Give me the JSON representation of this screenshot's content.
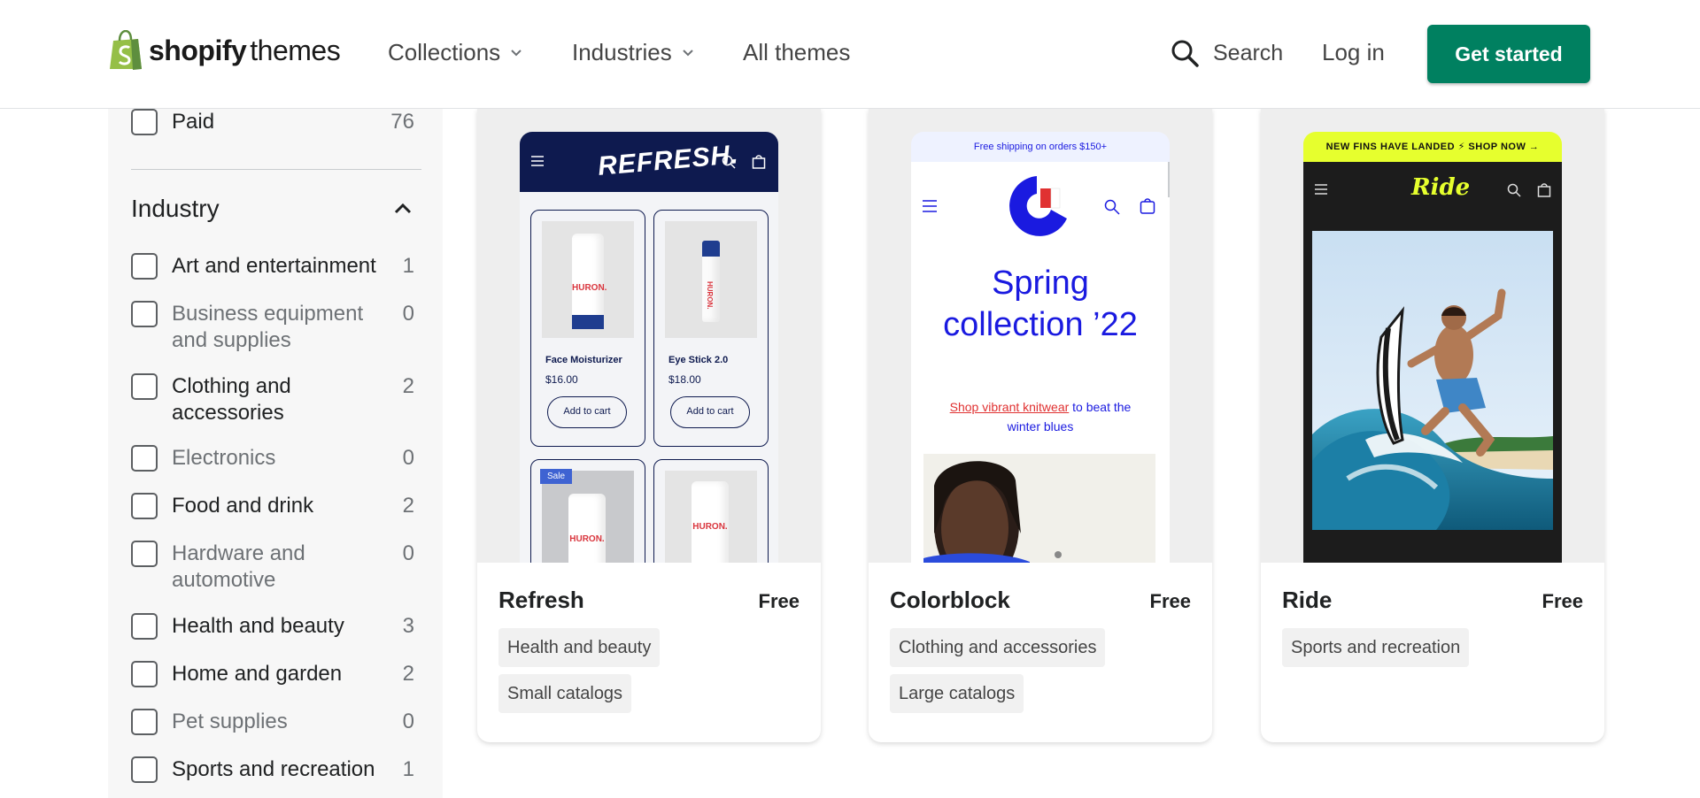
{
  "header": {
    "logo_bold": "shopify",
    "logo_light": "themes",
    "nav": [
      {
        "label": "Collections"
      },
      {
        "label": "Industries"
      },
      {
        "label": "All themes"
      }
    ],
    "search_label": "Search",
    "login_label": "Log in",
    "cta_label": "Get started",
    "accent_color": "#008060"
  },
  "sidebar": {
    "paid": {
      "label": "Paid",
      "count": "76"
    },
    "industry_heading": "Industry",
    "industries": [
      {
        "label": "Art and entertainment",
        "count": "1"
      },
      {
        "label": "Business equipment and supplies",
        "count": "0"
      },
      {
        "label": "Clothing and accessories",
        "count": "2"
      },
      {
        "label": "Electronics",
        "count": "0"
      },
      {
        "label": "Food and drink",
        "count": "2"
      },
      {
        "label": "Hardware and automotive",
        "count": "0"
      },
      {
        "label": "Health and beauty",
        "count": "3"
      },
      {
        "label": "Home and garden",
        "count": "2"
      },
      {
        "label": "Pet supplies",
        "count": "0"
      },
      {
        "label": "Sports and recreation",
        "count": "1"
      }
    ]
  },
  "themes": [
    {
      "name": "Refresh",
      "price": "Free",
      "tags": [
        "Health and beauty",
        "Small catalogs"
      ],
      "preview": {
        "logo": "REFRESH.",
        "products": [
          {
            "name": "Face Moisturizer",
            "price": "$16.00",
            "button": "Add to cart",
            "brand": "HURON."
          },
          {
            "name": "Eye Stick 2.0",
            "price": "$18.00",
            "button": "Add to cart",
            "brand": "HURON."
          }
        ],
        "sale_badge": "Sale",
        "brand_lower_1": "HURON.",
        "brand_lower_2": "HURON."
      }
    },
    {
      "name": "Colorblock",
      "price": "Free",
      "tags": [
        "Clothing and accessories",
        "Large catalogs"
      ],
      "preview": {
        "announcement": "Free shipping on orders $150+",
        "headline_1": "Spring",
        "headline_2": "collection ’22",
        "link_text": "Shop vibrant knitwear",
        "sub_text": " to beat the winter blues"
      }
    },
    {
      "name": "Ride",
      "price": "Free",
      "tags": [
        "Sports and recreation"
      ],
      "preview": {
        "announcement": "NEW FINS HAVE LANDED ⚡ SHOP NOW →",
        "logo": "Ride"
      }
    }
  ]
}
